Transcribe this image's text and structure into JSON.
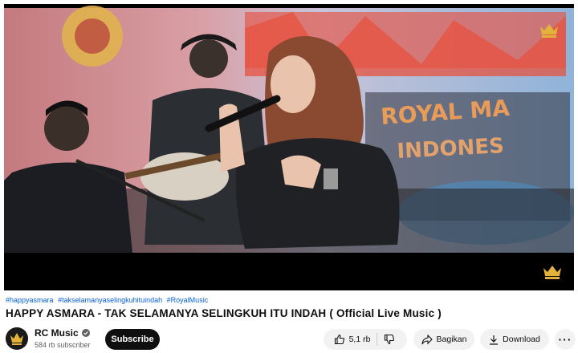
{
  "video": {
    "hashtags": [
      "#happyasmara",
      "#takselamanyaselingkuhituindah",
      "#RoyalMusic"
    ],
    "title": "HAPPY ASMARA - TAK SELAMANYA SELINGKUH ITU INDAH ( Official Live Music )",
    "graffiti_text": [
      "ROYAL MA",
      "INDONES"
    ]
  },
  "channel": {
    "name": "RC Music",
    "subscribers": "584 rb subscriber",
    "avatar_icon": "rc-crown-logo",
    "verified_icon": "verified-check-icon"
  },
  "actions": {
    "subscribe_label": "Subscribe",
    "like_count": "5,1 rb",
    "share_label": "Bagikan",
    "download_label": "Download",
    "more_label": "···"
  },
  "colors": {
    "link": "#065fd4",
    "subscribe_bg": "#0f0f0f",
    "chip_bg": "#f2f2f2",
    "watermark_gold": "#e2b23a"
  }
}
